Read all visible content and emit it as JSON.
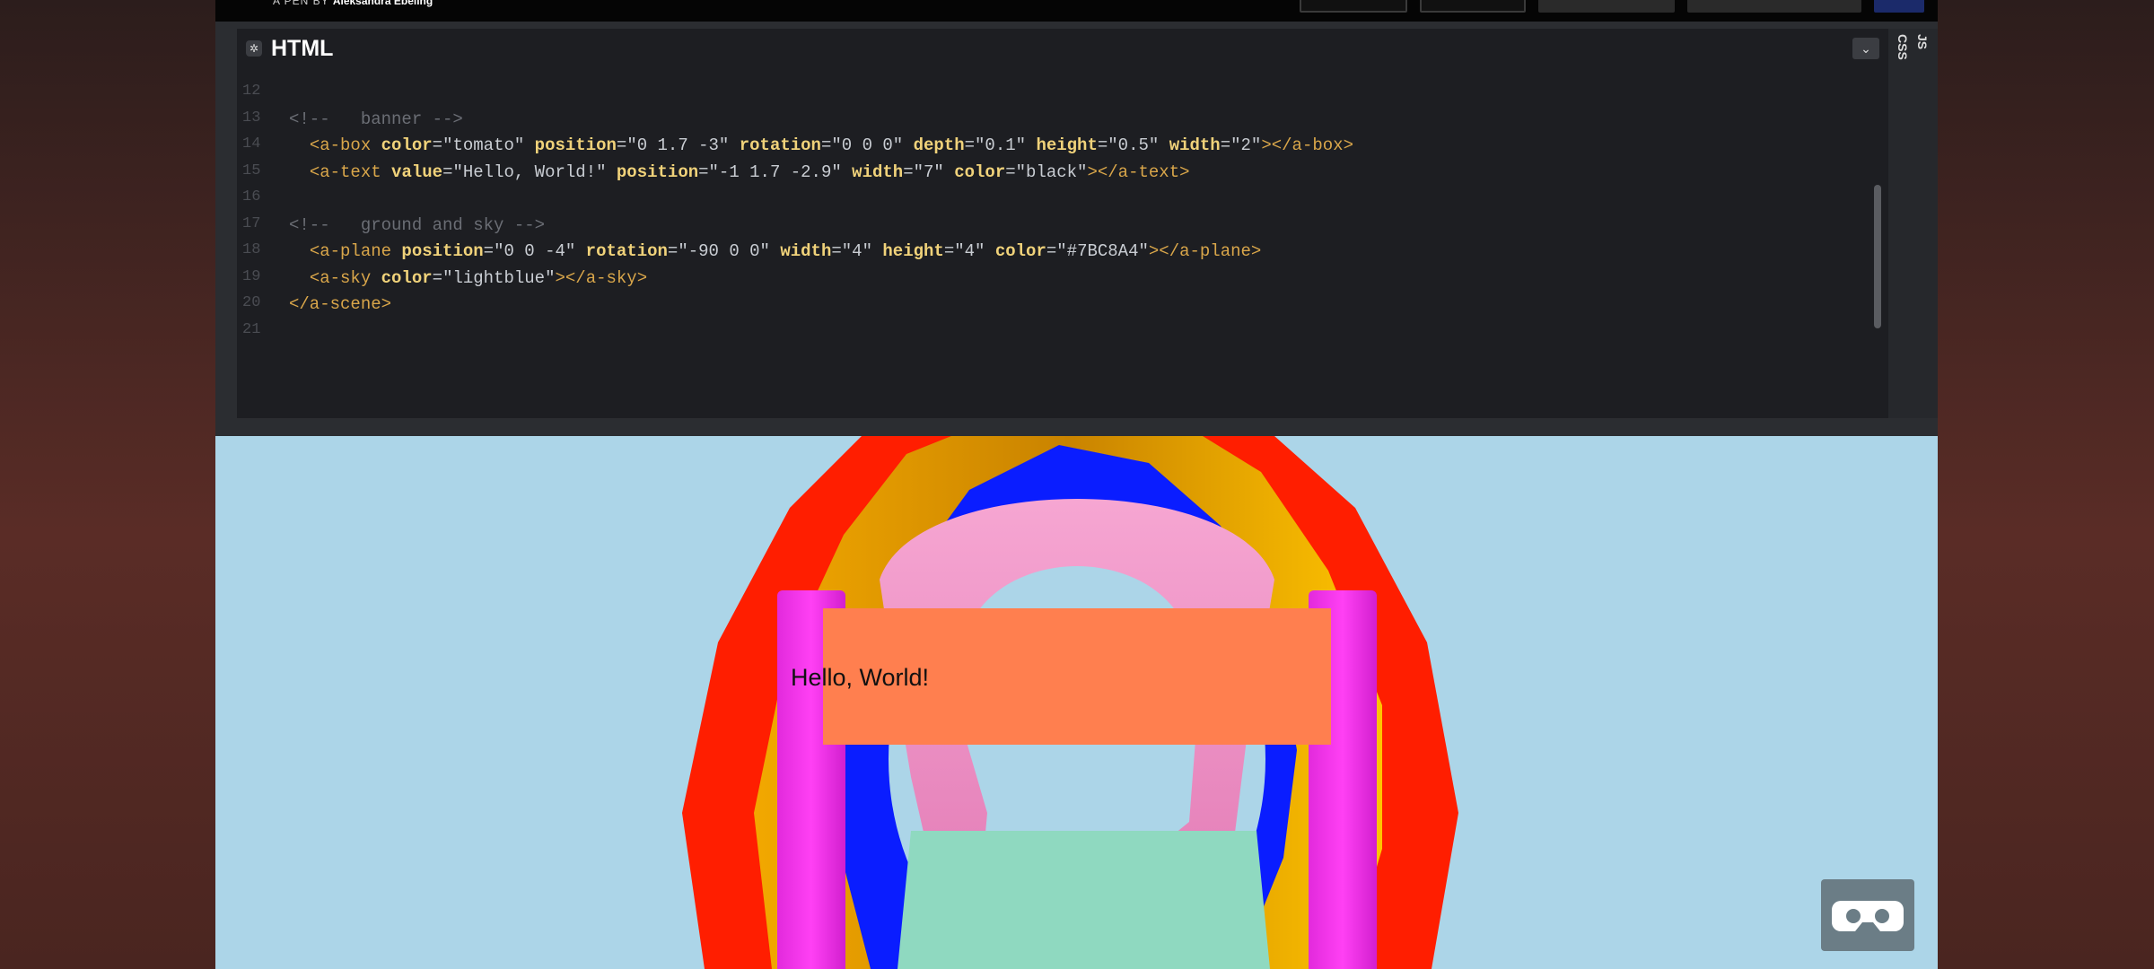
{
  "topbar": {
    "pen_by_prefix": "A PEN BY",
    "author": "Aleksandra Ebeling"
  },
  "editor": {
    "panel_title": "HTML",
    "gear_glyph": "✲",
    "collapse_glyph": "⌄",
    "side_tabs": [
      "CSS",
      "JS"
    ],
    "lines": [
      {
        "n": "12",
        "code": ""
      },
      {
        "n": "13",
        "code": "<!--   banner -->"
      },
      {
        "n": "14",
        "code": "  <a-box color=\"tomato\" position=\"0 1.7 -3\" rotation=\"0 0 0\" depth=\"0.1\" height=\"0.5\" width=\"2\"></a-box>"
      },
      {
        "n": "15",
        "code": "  <a-text value=\"Hello, World!\" position=\"-1 1.7 -2.9\" width=\"7\" color=\"black\"></a-text>"
      },
      {
        "n": "16",
        "code": ""
      },
      {
        "n": "17",
        "code": "<!--   ground and sky -->"
      },
      {
        "n": "18",
        "code": "  <a-plane position=\"0 0 -4\" rotation=\"-90 0 0\" width=\"4\" height=\"4\" color=\"#7BC8A4\"></a-plane>"
      },
      {
        "n": "19",
        "code": "  <a-sky color=\"lightblue\"></a-sky>"
      },
      {
        "n": "20",
        "code": "</a-scene>"
      },
      {
        "n": "21",
        "code": ""
      }
    ]
  },
  "scene": {
    "banner_text": "Hello, World!",
    "colors": {
      "sky": "#acd5e8",
      "ground": "#8fd9c0",
      "ring_outer": "#ff2200",
      "ring_orange": "#ffb300",
      "ring_blue": "#0a1dff",
      "ring_pink": "#f39ac8",
      "pillars": "#ff33ee",
      "banner": "#ff7f50"
    },
    "vr_icon": "vr-goggles-icon"
  }
}
